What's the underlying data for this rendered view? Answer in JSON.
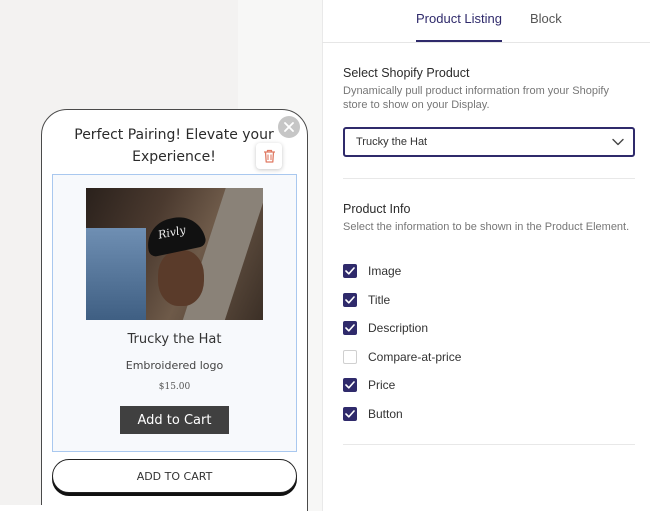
{
  "popup": {
    "title": "Perfect Pairing! Elevate your Experience!",
    "product": {
      "name": "Trucky the Hat",
      "description": "Embroidered logo",
      "price": "$15.00",
      "image_logo": "Rivly",
      "add_to_cart_label": "Add to Cart"
    },
    "secondary_button_label": "ADD TO CART"
  },
  "tabs": [
    {
      "label": "Product Listing",
      "active": true
    },
    {
      "label": "Block",
      "active": false
    }
  ],
  "select_product": {
    "title": "Select Shopify Product",
    "description": "Dynamically pull product information from your Shopify store to show on your Display.",
    "value": "Trucky the Hat"
  },
  "product_info": {
    "title": "Product Info",
    "description": "Select the information to be shown in the Product Element.",
    "options": [
      {
        "label": "Image",
        "checked": true
      },
      {
        "label": "Title",
        "checked": true
      },
      {
        "label": "Description",
        "checked": true
      },
      {
        "label": "Compare-at-price",
        "checked": false
      },
      {
        "label": "Price",
        "checked": true
      },
      {
        "label": "Button",
        "checked": true
      }
    ]
  },
  "colors": {
    "accent": "#2f2a6b",
    "dark_button": "#404040",
    "selection_outline": "#a9c8ef",
    "delete_icon": "#e07a63"
  },
  "icons": {
    "close": "close-icon",
    "delete": "trash-icon",
    "dropdown": "chevron-down-icon",
    "check": "check-icon"
  }
}
